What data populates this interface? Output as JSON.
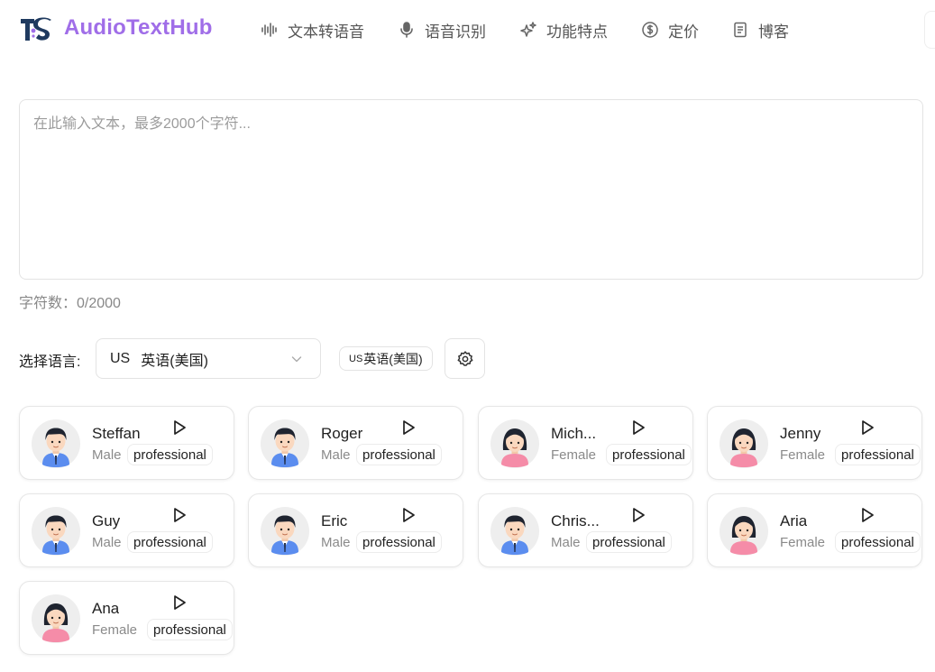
{
  "brand": {
    "name": "AudioTextHub",
    "logo_text": "TS"
  },
  "nav": [
    {
      "label": "文本转语音",
      "icon": "waveform-icon"
    },
    {
      "label": "语音识别",
      "icon": "microphone-icon"
    },
    {
      "label": "功能特点",
      "icon": "sparkles-icon"
    },
    {
      "label": "定价",
      "icon": "dollar-icon"
    },
    {
      "label": "博客",
      "icon": "document-icon"
    }
  ],
  "editor": {
    "placeholder": "在此输入文本，最多2000个字符...",
    "char_count": "字符数：0/2000"
  },
  "language": {
    "label": "选择语言:",
    "selected_code": "US",
    "selected_name": "英语(美国)",
    "chip_code": "US",
    "chip_name": "英语(美国)"
  },
  "voices": [
    {
      "name": "Steffan",
      "gender": "Male",
      "tag": "professional"
    },
    {
      "name": "Roger",
      "gender": "Male",
      "tag": "professional"
    },
    {
      "name": "Mich...",
      "gender": "Female",
      "tag": "professional"
    },
    {
      "name": "Jenny",
      "gender": "Female",
      "tag": "professional"
    },
    {
      "name": "Guy",
      "gender": "Male",
      "tag": "professional"
    },
    {
      "name": "Eric",
      "gender": "Male",
      "tag": "professional"
    },
    {
      "name": "Chris...",
      "gender": "Male",
      "tag": "professional"
    },
    {
      "name": "Aria",
      "gender": "Female",
      "tag": "professional"
    },
    {
      "name": "Ana",
      "gender": "Female",
      "tag": "professional"
    }
  ],
  "colors": {
    "brand": "#a06ee8",
    "logo_dark": "#1f3a5f"
  }
}
